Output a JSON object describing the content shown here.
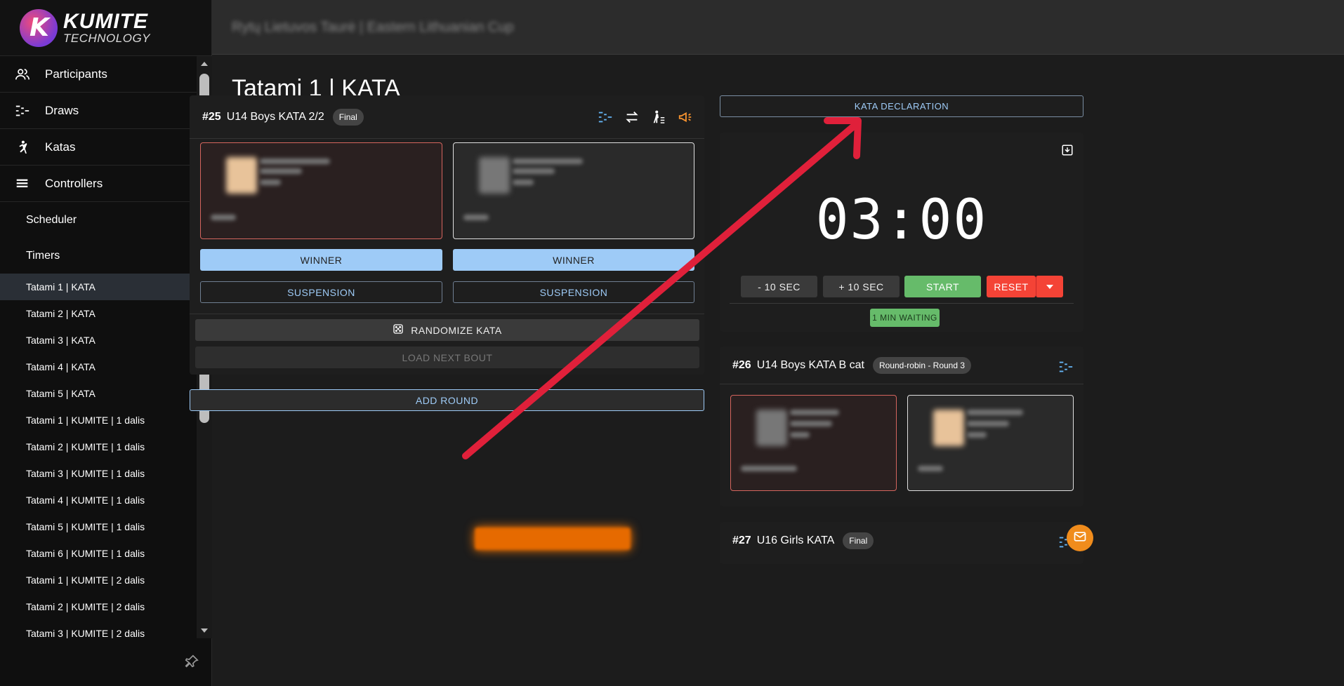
{
  "logo": {
    "title": "KUMITE",
    "subtitle": "TECHNOLOGY"
  },
  "header": {
    "title": "Rytų Lietuvos Taurė | Eastern Lithuanian Cup"
  },
  "sidebar": {
    "main_items": [
      {
        "label": "Participants",
        "icon": "people-icon"
      },
      {
        "label": "Draws",
        "icon": "draws-icon"
      },
      {
        "label": "Katas",
        "icon": "kata-icon"
      },
      {
        "label": "Controllers",
        "icon": "controllers-icon"
      }
    ],
    "sub_items": [
      {
        "label": "Scheduler"
      },
      {
        "label": "Timers"
      }
    ],
    "tatami_items": [
      {
        "label": "Tatami 1 | KATA",
        "active": true
      },
      {
        "label": "Tatami 2 | KATA"
      },
      {
        "label": "Tatami 3 | KATA"
      },
      {
        "label": "Tatami 4 | KATA"
      },
      {
        "label": "Tatami 5 | KATA"
      },
      {
        "label": "Tatami 1 | KUMITE | 1 dalis"
      },
      {
        "label": "Tatami 2 | KUMITE | 1 dalis"
      },
      {
        "label": "Tatami 3 | KUMITE | 1 dalis"
      },
      {
        "label": "Tatami 4 | KUMITE | 1 dalis"
      },
      {
        "label": "Tatami 5 | KUMITE | 1 dalis"
      },
      {
        "label": "Tatami 6 | KUMITE | 1 dalis"
      },
      {
        "label": "Tatami 1 | KUMITE | 2 dalis"
      },
      {
        "label": "Tatami 2 | KUMITE | 2 dalis"
      },
      {
        "label": "Tatami 3 | KUMITE | 2 dalis"
      }
    ]
  },
  "main": {
    "title": "Tatami 1 | KATA",
    "current_bout": {
      "number": "#25",
      "name": "U14 Boys KATA 2/2",
      "chip": "Final",
      "winner_label": "WINNER",
      "suspension_label": "SUSPENSION",
      "randomize_label": "RANDOMIZE KATA",
      "load_next_label": "LOAD NEXT BOUT"
    },
    "add_round_label": "ADD ROUND",
    "kata_declaration_label": "KATA DECLARATION",
    "timer": {
      "time": "03:00",
      "minus_label": "- 10 SEC",
      "plus_label": "+ 10 SEC",
      "start_label": "START",
      "reset_label": "RESET",
      "waiting_label": "1 MIN WAITING"
    },
    "bout_26": {
      "number": "#26",
      "name": "U14 Boys KATA B cat",
      "chip": "Round-robin - Round 3"
    },
    "bout_27": {
      "number": "#27",
      "name": "U16 Girls KATA",
      "chip": "Final"
    }
  },
  "colors": {
    "accent_blue": "#9ecbf7",
    "green": "#66bb6a",
    "red": "#f44336",
    "annotation_arrow": "#e0203a"
  }
}
